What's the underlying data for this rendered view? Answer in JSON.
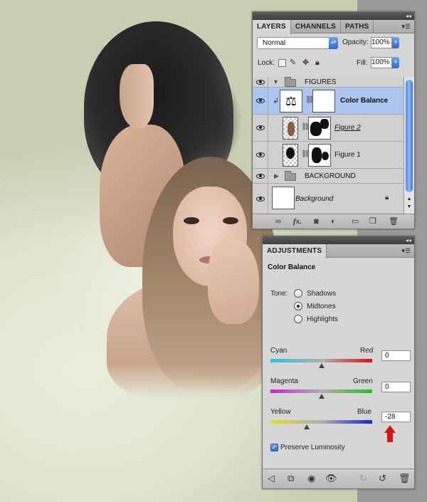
{
  "layers_panel": {
    "tabs": [
      "LAYERS",
      "CHANNELS",
      "PATHS"
    ],
    "blend_mode": "Normal",
    "opacity_label": "Opacity:",
    "opacity_value": "100%",
    "lock_label": "Lock:",
    "fill_label": "Fill:",
    "fill_value": "100%",
    "layers": [
      {
        "name": "FIGURES",
        "type": "group",
        "expanded": true
      },
      {
        "name": "Color Balance",
        "type": "adjustment",
        "selected": true
      },
      {
        "name": "Figure 2",
        "type": "layer"
      },
      {
        "name": "Figure 1",
        "type": "layer"
      },
      {
        "name": "BACKGROUND",
        "type": "group",
        "expanded": false
      },
      {
        "name": "Background",
        "type": "background",
        "locked": true
      }
    ],
    "bottom_icons": [
      "link-icon",
      "fx-icon",
      "mask-icon",
      "adjustment-icon",
      "new-group-icon",
      "new-layer-icon",
      "trash-icon"
    ],
    "fx_label": "fx."
  },
  "adjustments_panel": {
    "tab": "ADJUSTMENTS",
    "title": "Color Balance",
    "tone_label": "Tone:",
    "tones": [
      {
        "label": "Shadows",
        "selected": false
      },
      {
        "label": "Midtones",
        "selected": true
      },
      {
        "label": "Highlights",
        "selected": false
      }
    ],
    "sliders": [
      {
        "left": "Cyan",
        "right": "Red",
        "value": "0",
        "level": 0
      },
      {
        "left": "Magenta",
        "right": "Green",
        "value": "0",
        "level": 0
      },
      {
        "left": "Yellow",
        "right": "Blue",
        "value": "-28",
        "level": -28
      }
    ],
    "slider_range": [
      -100,
      100
    ],
    "preserve_luminosity_label": "Preserve Luminosity",
    "preserve_luminosity_checked": true,
    "bottom_icons": [
      "back-arrow-icon",
      "clip-icon",
      "visibility-toggle-icon",
      "eye-icon",
      "view-previous-icon",
      "reset-icon",
      "trash-icon"
    ]
  },
  "colors": {
    "selection": "#a9c5f0",
    "accent_blue": "#2f6ad6",
    "arrow_red": "#d01818"
  }
}
